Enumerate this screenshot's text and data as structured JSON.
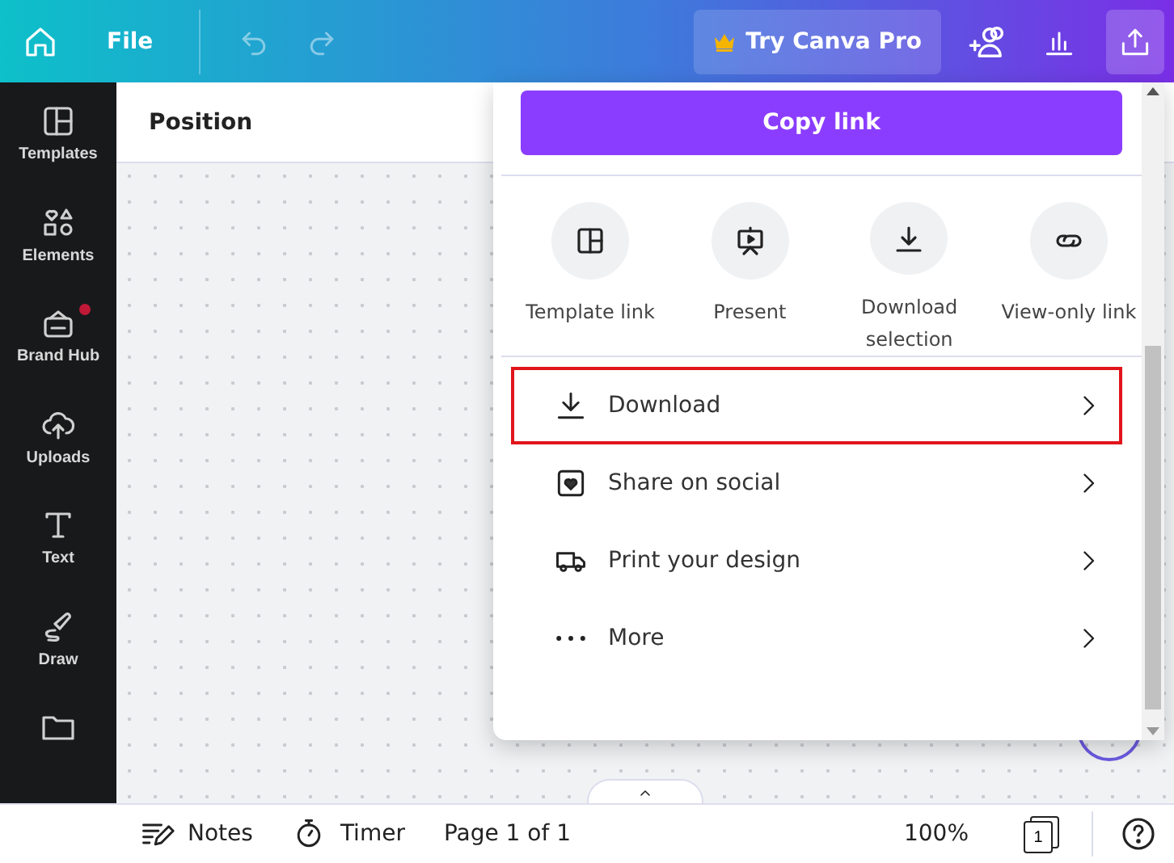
{
  "topbar": {
    "file": "File",
    "pro_button": "Try Canva Pro"
  },
  "sidebar": {
    "items": [
      {
        "kind": "templates",
        "label": "Templates",
        "badge": false
      },
      {
        "kind": "elements",
        "label": "Elements",
        "badge": false
      },
      {
        "kind": "brand",
        "label": "Brand Hub",
        "badge": true
      },
      {
        "kind": "uploads",
        "label": "Uploads",
        "badge": false
      },
      {
        "kind": "text",
        "label": "Text",
        "badge": false
      },
      {
        "kind": "draw",
        "label": "Draw",
        "badge": false
      },
      {
        "kind": "folder",
        "badge": false
      }
    ]
  },
  "toolbar": {
    "label": "Position"
  },
  "share_panel": {
    "copy_button": "Copy link",
    "options": [
      {
        "kind": "template",
        "label": "Template link"
      },
      {
        "kind": "present",
        "label": "Present"
      },
      {
        "kind": "download",
        "label": "Download selection"
      },
      {
        "kind": "link",
        "label": "View-only link"
      }
    ],
    "menu": [
      {
        "kind": "download",
        "label": "Download",
        "highlighted": true
      },
      {
        "kind": "social",
        "label": "Share on social",
        "highlighted": false
      },
      {
        "kind": "print",
        "label": "Print your design",
        "highlighted": false
      },
      {
        "kind": "more",
        "label": "More",
        "highlighted": false
      }
    ]
  },
  "bottombar": {
    "notes": "Notes",
    "timer": "Timer",
    "page": "Page 1 of 1",
    "zoom": "100%",
    "page_count": "1"
  }
}
